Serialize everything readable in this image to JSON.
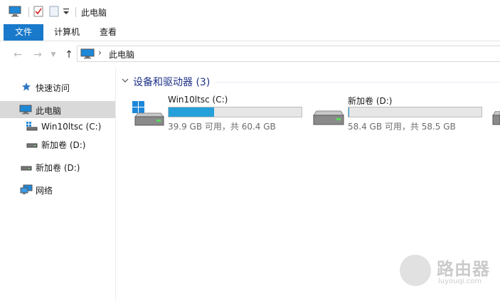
{
  "window": {
    "title": "此电脑"
  },
  "ribbon": {
    "tabs": [
      "文件",
      "计算机",
      "查看"
    ]
  },
  "address": {
    "path": "此电脑"
  },
  "sidebar": {
    "items": [
      {
        "label": "快速访问"
      },
      {
        "label": "此电脑",
        "selected": true
      },
      {
        "label": "Win10ltsc (C:)"
      },
      {
        "label": "新加卷 (D:)"
      },
      {
        "label": "新加卷 (D:)"
      },
      {
        "label": "网络"
      }
    ]
  },
  "content": {
    "group_title": "设备和驱动器 (3)",
    "drives": [
      {
        "name": "Win10ltsc (C:)",
        "info": "39.9 GB 可用，共 60.4 GB",
        "used_fraction": 0.34,
        "icon": "windows-drive-icon"
      },
      {
        "name": "新加卷 (D:)",
        "info": "58.4 GB 可用，共 58.5 GB",
        "used_fraction": 0.002,
        "icon": "drive-icon"
      }
    ]
  },
  "watermark": {
    "text": "路由器",
    "sub": "luyouqi.com"
  },
  "colors": {
    "accent": "#1979ca",
    "bar_fill": "#26a0da",
    "group_title": "#1e3287",
    "selected_bg": "#d9d9d9"
  }
}
